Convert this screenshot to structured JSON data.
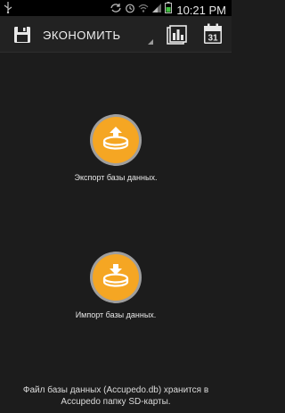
{
  "status_bar": {
    "time": "10:21 PM",
    "icons": [
      "usb-icon",
      "sync-icon",
      "alarm-icon",
      "wifi-icon",
      "signal-icon",
      "battery-icon"
    ]
  },
  "action_bar": {
    "account_label": "ЭКОНОМИТЬ",
    "calendar_day": "31",
    "icons": [
      "save-icon",
      "chart-icon",
      "calendar-icon"
    ]
  },
  "export": {
    "label": "Экспорт базы данных.",
    "icon": "database-export-icon"
  },
  "import": {
    "label": "Импорт базы данных.",
    "icon": "database-import-icon"
  },
  "footer": {
    "line1": "Файл базы данных (Accupedo.db) хранится в",
    "line2": "Accupedo папку SD-карты."
  },
  "colors": {
    "background": "#1c1c1c",
    "accent_orange": "#f5a623",
    "ring_gray": "#9e9e9e"
  }
}
